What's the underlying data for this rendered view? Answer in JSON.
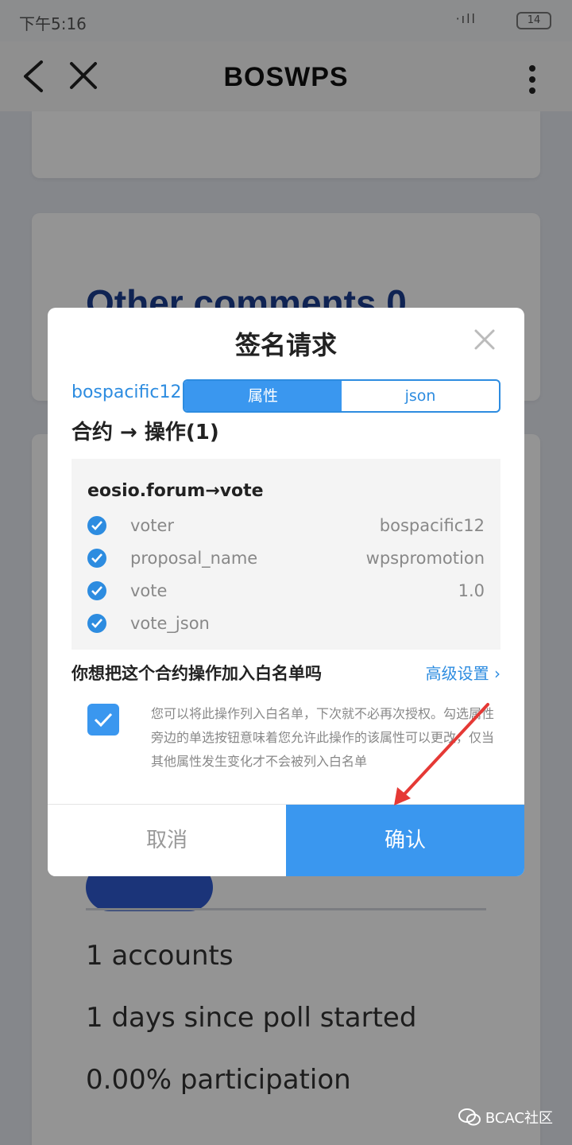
{
  "status_bar": {
    "time": "下午5:16",
    "signal": "·ıll",
    "battery": "14"
  },
  "nav": {
    "title": "BOSWPS",
    "icons": [
      "back-icon",
      "close-icon",
      "more-icon"
    ]
  },
  "page": {
    "heading": "Other comments 0",
    "stats": [
      "1 accounts",
      "1 days since poll started",
      "0.00% participation"
    ]
  },
  "dialog": {
    "title": "签名请求",
    "account": "bospacific12@",
    "tabs": [
      {
        "label": "属性",
        "active": true
      },
      {
        "label": "json",
        "active": false
      }
    ],
    "action_header": "合约 → 操作(1)",
    "action_name": "eosio.forum→vote",
    "params": [
      {
        "key": "voter",
        "value": "bospacific12"
      },
      {
        "key": "proposal_name",
        "value": "wpspromotion"
      },
      {
        "key": "vote",
        "value": "1.0"
      },
      {
        "key": "vote_json",
        "value": ""
      }
    ],
    "whitelist_question": "你想把这个合约操作加入白名单吗",
    "advanced_label": "高级设置 ›",
    "whitelist_checked": true,
    "whitelist_desc": "您可以将此操作列入白名单，下次就不必再次授权。勾选属性旁边的单选按钮意味着您允许此操作的该属性可以更改，仅当其他属性发生变化才不会被列入白名单",
    "cancel_label": "取消",
    "confirm_label": "确认"
  },
  "watermark": "BCAC社区",
  "colors": {
    "accent": "#3a97ef",
    "heading": "#1b3d8f",
    "annotation_arrow": "#e53935"
  }
}
